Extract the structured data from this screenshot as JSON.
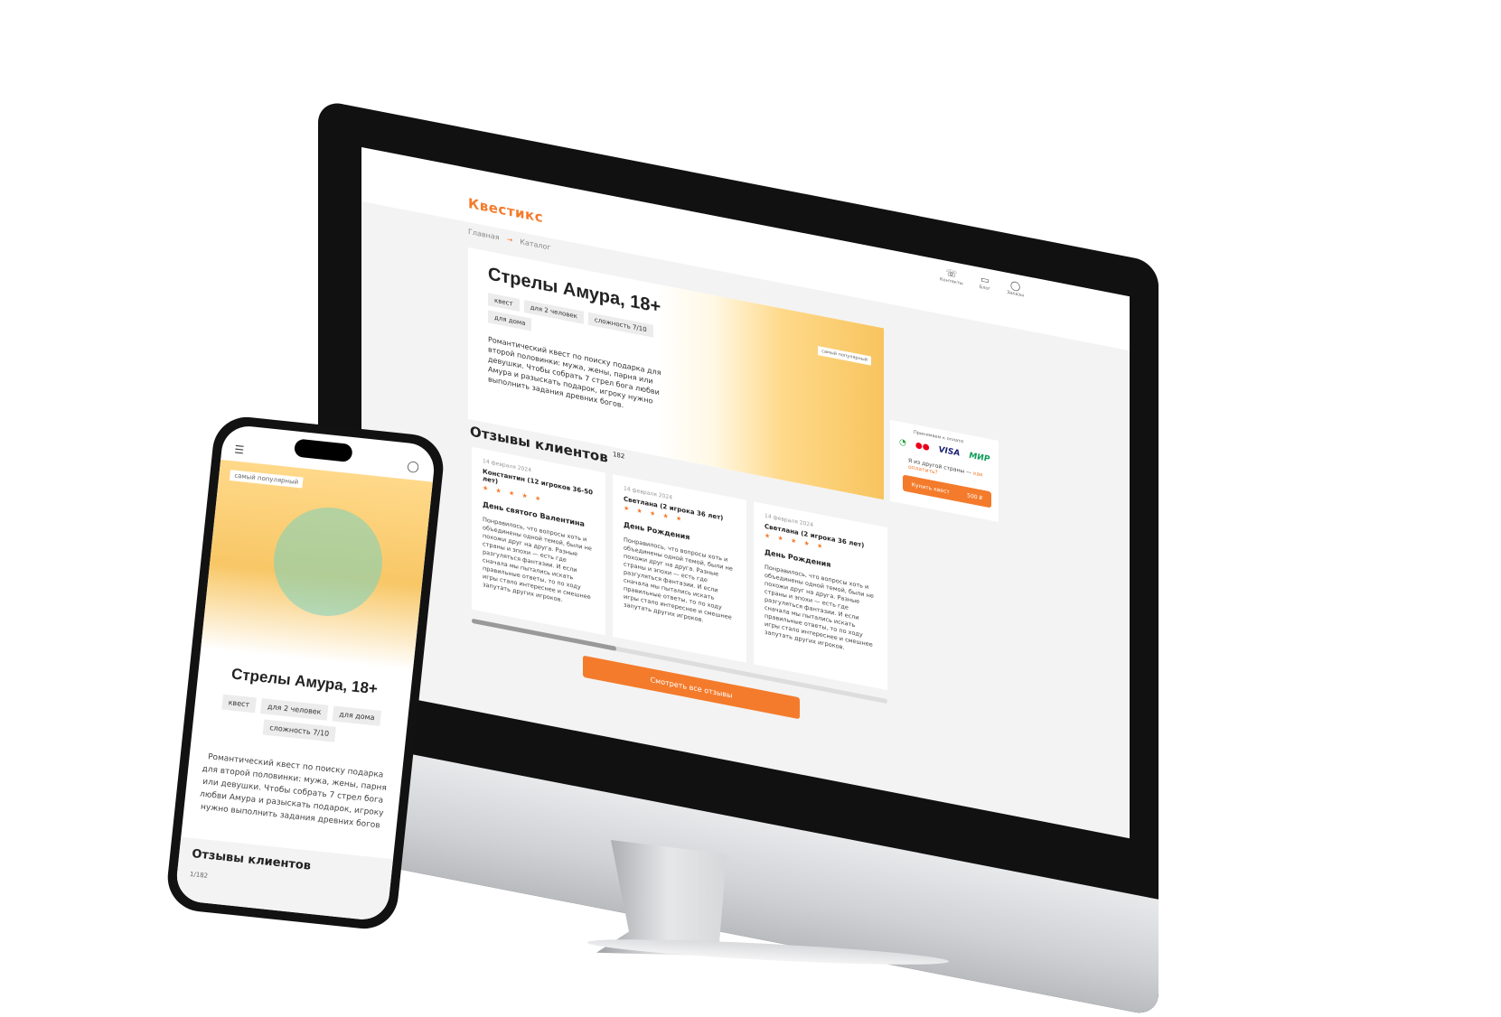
{
  "header": {
    "logo": "Квестикс",
    "icons": [
      {
        "icon": "phone-icon",
        "label": "Контакты"
      },
      {
        "icon": "book-icon",
        "label": "Блог"
      },
      {
        "icon": "user-icon",
        "label": "Заказы"
      }
    ]
  },
  "breadcrumbs": [
    "Главная",
    "Каталог"
  ],
  "breadcrumb_separator": "→",
  "quest": {
    "title": "Стрелы Амура, 18+",
    "tags": [
      "квест",
      "для 2 человек",
      "сложность 7/10",
      "для дома"
    ],
    "description": "Романтический квест по поиску подарка для второй половинки: мужа, жены, парня или девушки. Чтобы собрать 7 стрел бога любви Амура и разыскать подарок, игроку нужно выполнить задания древних богов.",
    "badge": "самый популярный"
  },
  "payment": {
    "label": "Принимаем к оплате",
    "methods": [
      "Сбер",
      "Mastercard",
      "VISA",
      "МИР"
    ],
    "other_country": "Я из другой страны —",
    "how_to_pay": "как оплатить?",
    "buy_label": "Купить квест",
    "price": "500 ₽"
  },
  "reviews": {
    "title": "Отзывы клиентов",
    "count": "182",
    "items": [
      {
        "date": "14 февраля 2024",
        "author": "Константин (12 игроков 36-50 лет)",
        "stars": "★ ★ ★ ★ ★",
        "topic": "День святого Валентина",
        "text": "Понравилось, что вопросы хоть и объединены одной темой, были не похожи друг на друга. Разные страны и эпохи — есть где разгуляться фантазии. И если сначала мы пытались искать правильные ответы, то по ходу игры стало интереснее и смешнее запутать других игроков."
      },
      {
        "date": "14 февраля 2024",
        "author": "Светлана (2 игрока 36 лет)",
        "stars": "★ ★ ★ ★ ★",
        "topic": "День Рождения",
        "text": "Понравилось, что вопросы хоть и объединены одной темой, были не похожи друг на друга. Разные страны и эпохи — есть где разгуляться фантазии. И если сначала мы пытались искать правильные ответы, то по ходу игры стало интереснее и смешнее запутать других игроков."
      },
      {
        "date": "14 февраля 2024",
        "author": "Светлана (2 игрока 36 лет)",
        "stars": "★ ★ ★ ★ ★",
        "topic": "День Рождения",
        "text": "Понравилось, что вопросы хоть и объединены одной темой, были не похожи друг на друга. Разные страны и эпохи — есть где разгуляться фантазии. И если сначала мы пытались искать правильные ответы, то по ходу игры стало интереснее и смешнее запутать других игроков."
      }
    ],
    "all_label": "Смотреть все отзывы"
  },
  "mobile": {
    "badge": "самый популярный",
    "title": "Стрелы Амура, 18+",
    "tags": [
      "квест",
      "для 2 человек",
      "для дома",
      "сложность 7/10"
    ],
    "description": "Романтический квест по поиску подарка для второй половинки: мужа, жены, парня или девушки. Чтобы собрать 7 стрел бога любви Амура и разыскать подарок, игроку нужно выполнить задания древних богов",
    "reviews_title": "Отзывы клиентов",
    "reviews_counter": "1/182"
  },
  "colors": {
    "accent": "#f47b2b",
    "background": "#f3f3f3"
  }
}
